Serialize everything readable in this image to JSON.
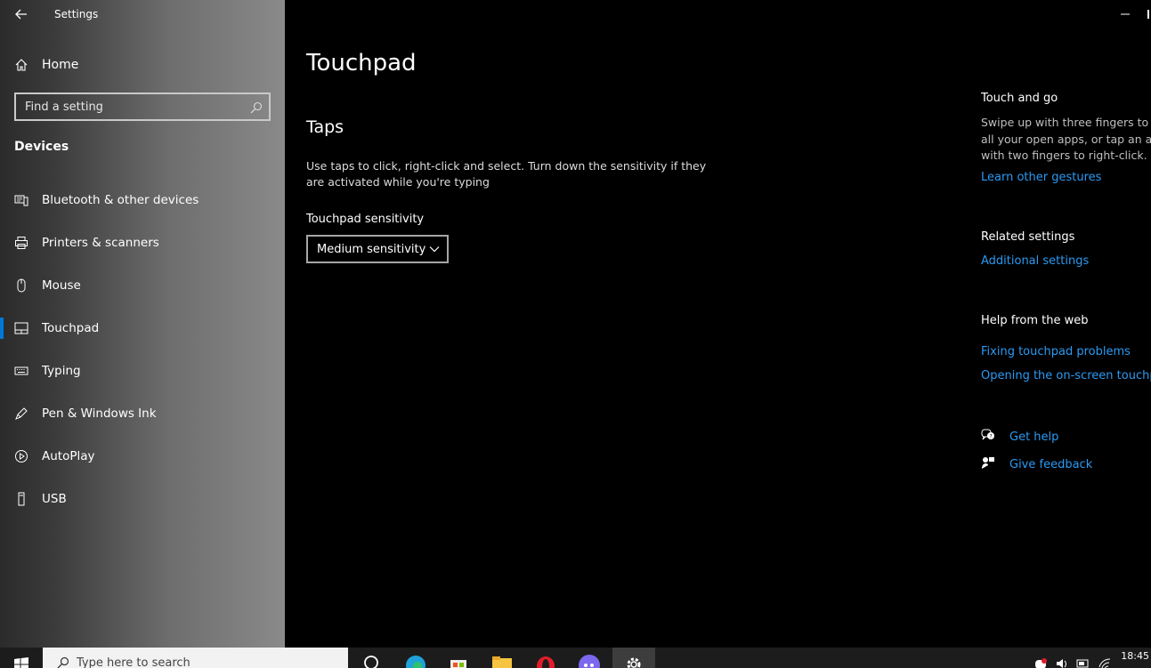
{
  "window": {
    "title": "Settings"
  },
  "sidebar": {
    "home_label": "Home",
    "search_placeholder": "Find a setting",
    "section_label": "Devices",
    "items": [
      {
        "label": "Bluetooth & other devices",
        "icon": "bluetooth-devices-icon"
      },
      {
        "label": "Printers & scanners",
        "icon": "printer-icon"
      },
      {
        "label": "Mouse",
        "icon": "mouse-icon"
      },
      {
        "label": "Touchpad",
        "icon": "touchpad-icon",
        "active": true
      },
      {
        "label": "Typing",
        "icon": "keyboard-icon"
      },
      {
        "label": "Pen & Windows Ink",
        "icon": "pen-icon"
      },
      {
        "label": "AutoPlay",
        "icon": "autoplay-icon"
      },
      {
        "label": "USB",
        "icon": "usb-icon"
      }
    ]
  },
  "main": {
    "page_title": "Touchpad",
    "taps_title": "Taps",
    "taps_description": "Use taps to click, right-click and select. Turn down the sensitivity if they are activated while you're typing",
    "sensitivity_label": "Touchpad sensitivity",
    "sensitivity_value": "Medium sensitivity"
  },
  "right_panel": {
    "touch_heading": "Touch and go",
    "touch_lines": [
      "Swipe up with three fingers to s",
      "all your open apps, or tap an ap",
      "with two fingers to right-click."
    ],
    "learn_gestures_link": "Learn other gestures",
    "related_heading": "Related settings",
    "additional_settings_link": "Additional settings",
    "help_heading": "Help from the web",
    "help_links": [
      "Fixing touchpad problems",
      "Opening the on-screen touchpa"
    ],
    "get_help": "Get help",
    "give_feedback": "Give feedback"
  },
  "taskbar": {
    "search_placeholder": "Type here to search",
    "clock": "18:45"
  },
  "colors": {
    "accent": "#0078d7",
    "link": "#2b9af3"
  }
}
